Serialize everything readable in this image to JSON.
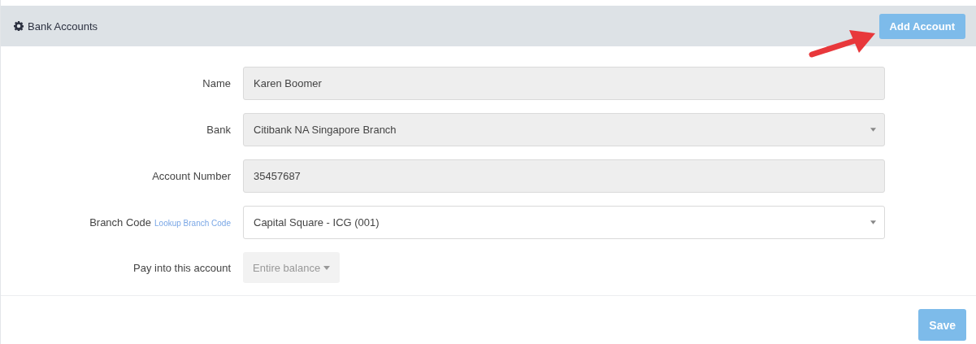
{
  "panel": {
    "title": "Bank Accounts",
    "add_button": "Add Account"
  },
  "fields": [
    {
      "kind": "input",
      "label": "Name",
      "value": "Karen Boomer",
      "disabled": true
    },
    {
      "kind": "select",
      "label": "Bank",
      "value": "Citibank NA Singapore Branch",
      "disabled": true
    },
    {
      "kind": "input",
      "label": "Account Number",
      "value": "35457687",
      "disabled": true
    },
    {
      "kind": "select",
      "label": "Branch Code",
      "link": "Lookup Branch Code",
      "value": "Capital Square - ICG (001)",
      "disabled": false
    },
    {
      "kind": "dropdown",
      "label": "Pay into this account",
      "value": "Entire balance",
      "disabled": true
    }
  ],
  "save_button": "Save"
}
